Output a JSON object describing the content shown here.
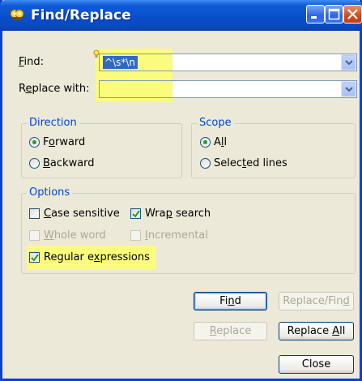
{
  "window": {
    "title": "Find/Replace"
  },
  "titlebar_buttons": {
    "minimize_icon": "minimize-icon",
    "maximize_icon": "maximize-icon",
    "close_icon": "close-icon"
  },
  "find": {
    "label_pre": "",
    "label_ul": "F",
    "label_post": "ind:",
    "value": "^\\s*\\n"
  },
  "replace": {
    "label_pre": "R",
    "label_ul": "e",
    "label_post": "place with:",
    "value": ""
  },
  "direction": {
    "title": "Direction",
    "forward": {
      "pre": "F",
      "ul": "o",
      "post": "rward",
      "selected": true
    },
    "backward": {
      "pre": "",
      "ul": "B",
      "post": "ackward",
      "selected": false
    }
  },
  "scope": {
    "title": "Scope",
    "all": {
      "pre": "A",
      "ul": "l",
      "post": "l",
      "selected": true
    },
    "selected_lines": {
      "pre": "Selec",
      "ul": "t",
      "post": "ed lines",
      "selected": false
    }
  },
  "options": {
    "title": "Options",
    "case_sensitive": {
      "pre": "",
      "ul": "C",
      "post": "ase sensitive",
      "checked": false,
      "enabled": true
    },
    "wrap_search": {
      "pre": "Wra",
      "ul": "p",
      "post": " search",
      "checked": true,
      "enabled": true
    },
    "whole_word": {
      "pre": "",
      "ul": "W",
      "post": "hole word",
      "checked": false,
      "enabled": false
    },
    "incremental": {
      "pre": "",
      "ul": "I",
      "post": "ncremental",
      "checked": false,
      "enabled": false
    },
    "regular_expressions": {
      "pre": "Regular e",
      "ul": "x",
      "post": "pressions",
      "checked": true,
      "enabled": true
    }
  },
  "buttons": {
    "find": {
      "pre": "Fi",
      "ul": "n",
      "post": "d"
    },
    "replace_find": {
      "pre": "Replace/Fin",
      "ul": "d",
      "post": ""
    },
    "replace": {
      "pre": "",
      "ul": "R",
      "post": "eplace"
    },
    "replace_all": {
      "pre": "Replace ",
      "ul": "A",
      "post": "ll"
    },
    "close": {
      "label": "Close"
    }
  },
  "colors": {
    "highlight": "#fbfb7e",
    "group_title": "#0046d5",
    "title_bar": "#0a4cc9"
  }
}
